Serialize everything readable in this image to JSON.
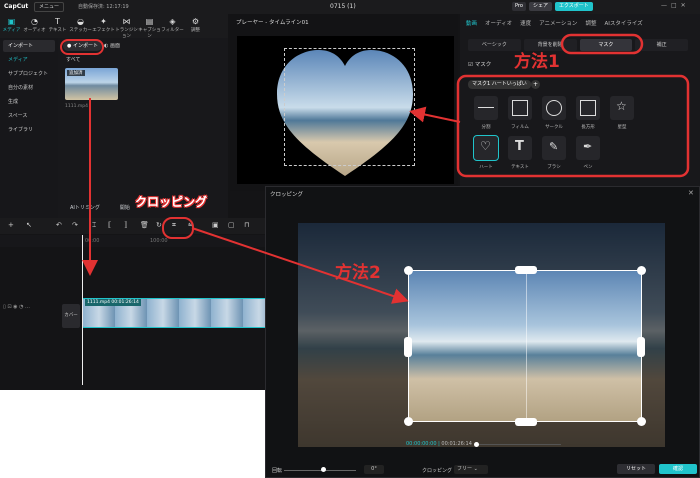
{
  "app": {
    "logo": "CapCut",
    "menu_label": "メニュー",
    "autosave": "自動保存済: 12:17:19",
    "project_title": "0715 (1)",
    "pro_label": "Pro",
    "share_label": "シェア",
    "export_label": "エクスポート"
  },
  "toolbar": {
    "items": [
      "メディア",
      "オーディオ",
      "テキスト",
      "ステッカー",
      "エフェクト",
      "トランジション",
      "キャプション",
      "フィルター",
      "調整"
    ]
  },
  "sidebar": {
    "items": [
      "インポート",
      "メディア",
      "サブプロジェクト",
      "自分の素材",
      "生成",
      "スペース",
      "ライブラリ"
    ]
  },
  "media": {
    "import_label": "インポート",
    "stock_label": "画面",
    "all_label": "すべて",
    "thumb_tag": "追加済",
    "file_name": "1111.mp4",
    "ai_label": "AIトリミング",
    "start_label": "開始"
  },
  "player": {
    "header": "プレーヤー - タイムライン01"
  },
  "props": {
    "tabs": [
      "動画",
      "オーディオ",
      "速度",
      "アニメーション",
      "調整",
      "AIスタイライズ"
    ],
    "subtabs": [
      "ベーシック",
      "背景を削除",
      "マスク",
      "補正"
    ],
    "mask_toggle": "マスク",
    "mask_pill": "マスク1 ハートいっぱい",
    "masks": [
      "分割",
      "フィルム",
      "サークル",
      "長方形",
      "星型",
      "ハート",
      "テキスト",
      "ブラシ",
      "ペン"
    ]
  },
  "timeline": {
    "time_marks": [
      "00:00",
      "100:00"
    ],
    "clip_label": "1111.mp4  00:01:26:14",
    "cover_label": "カバー"
  },
  "crop_window": {
    "title": "クロッピング",
    "current_time": "00:00:00:00",
    "total_time": "00:01:26:14",
    "rotate_label": "回転",
    "rotate_value": "0°",
    "crop_label": "クロッピング",
    "ratio_value": "フリー",
    "reset_label": "リセット",
    "ok_label": "確認"
  },
  "annotations": {
    "method1": "方法1",
    "method2": "方法2",
    "cropping": "クロッピング",
    "color": "#e23232"
  },
  "colors": {
    "accent": "#20c4cb"
  }
}
